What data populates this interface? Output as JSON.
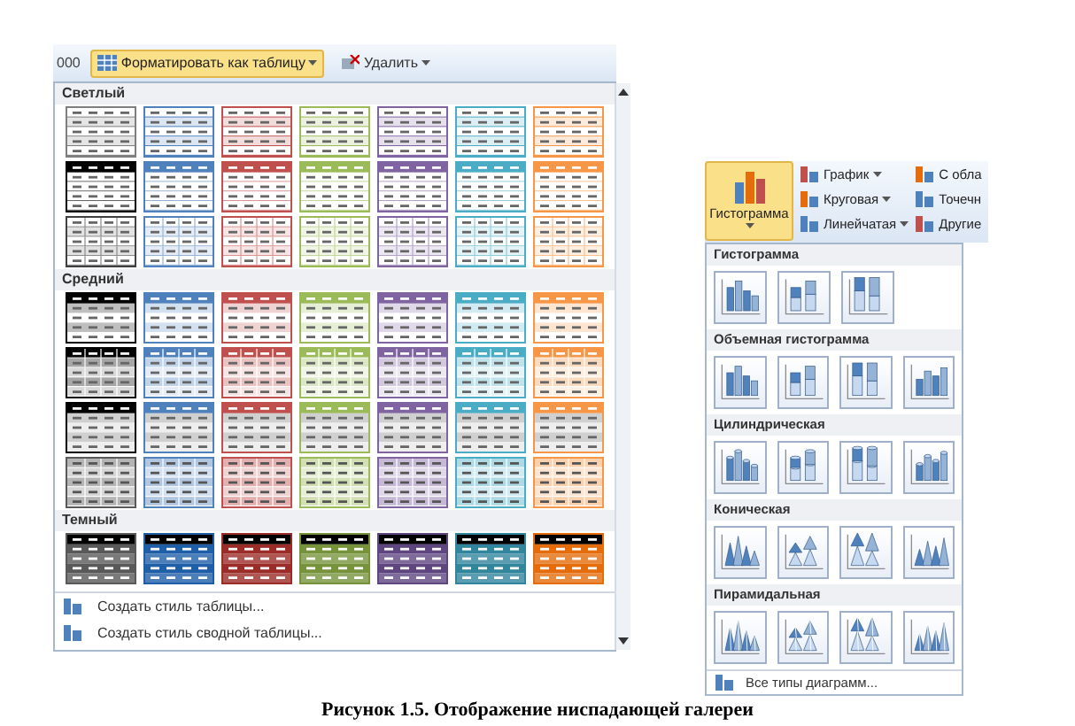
{
  "ribbon": {
    "number_format": "000",
    "format_button": {
      "label": "Форматировать как таблицу",
      "active": true
    },
    "delete_button": {
      "label": "Удалить"
    }
  },
  "table_styles": {
    "sections": [
      {
        "title": "Светлый",
        "rows": [
          {
            "kind": "lines",
            "items": [
              {
                "color": "#7f7f7f"
              },
              {
                "color": "#4f81bd"
              },
              {
                "color": "#c0504d"
              },
              {
                "color": "#9bbb59"
              },
              {
                "color": "#8064a2"
              },
              {
                "color": "#4bacc6"
              },
              {
                "color": "#f79646"
              }
            ]
          },
          {
            "kind": "header-border",
            "items": [
              {
                "color": "#000000"
              },
              {
                "color": "#4f81bd"
              },
              {
                "color": "#c0504d"
              },
              {
                "color": "#9bbb59"
              },
              {
                "color": "#8064a2"
              },
              {
                "color": "#4bacc6"
              },
              {
                "color": "#f79646"
              }
            ]
          },
          {
            "kind": "grid",
            "items": [
              {
                "color": "#404040"
              },
              {
                "color": "#4f81bd"
              },
              {
                "color": "#c0504d"
              },
              {
                "color": "#9bbb59"
              },
              {
                "color": "#8064a2"
              },
              {
                "color": "#4bacc6"
              },
              {
                "color": "#f79646"
              }
            ]
          }
        ]
      },
      {
        "title": "Средний",
        "rows": [
          {
            "kind": "header-bands",
            "items": [
              {
                "color": "#000000"
              },
              {
                "color": "#4f81bd"
              },
              {
                "color": "#c0504d"
              },
              {
                "color": "#9bbb59"
              },
              {
                "color": "#8064a2"
              },
              {
                "color": "#4bacc6"
              },
              {
                "color": "#f79646"
              }
            ]
          },
          {
            "kind": "grid-bands",
            "items": [
              {
                "color": "#000000"
              },
              {
                "color": "#4f81bd"
              },
              {
                "color": "#c0504d"
              },
              {
                "color": "#9bbb59"
              },
              {
                "color": "#8064a2"
              },
              {
                "color": "#4bacc6"
              },
              {
                "color": "#f79646"
              }
            ]
          },
          {
            "kind": "header-gray",
            "items": [
              {
                "color": "#000000"
              },
              {
                "color": "#4f81bd"
              },
              {
                "color": "#c0504d"
              },
              {
                "color": "#9bbb59"
              },
              {
                "color": "#8064a2"
              },
              {
                "color": "#4bacc6"
              },
              {
                "color": "#f79646"
              }
            ]
          },
          {
            "kind": "grid-filled",
            "items": [
              {
                "color": "#595959"
              },
              {
                "color": "#4f81bd"
              },
              {
                "color": "#c0504d"
              },
              {
                "color": "#9bbb59"
              },
              {
                "color": "#8064a2"
              },
              {
                "color": "#4bacc6"
              },
              {
                "color": "#f79646"
              }
            ]
          }
        ]
      },
      {
        "title": "Темный",
        "rows": [
          {
            "kind": "dark",
            "items": [
              {
                "color": "#595959"
              },
              {
                "color": "#1f5fa8"
              },
              {
                "color": "#9b2c28"
              },
              {
                "color": "#76933c"
              },
              {
                "color": "#5f4680"
              },
              {
                "color": "#31859c"
              },
              {
                "color": "#e46c0a"
              }
            ]
          }
        ]
      }
    ]
  },
  "table_menu": [
    {
      "label": "Создать стиль таблицы..."
    },
    {
      "label": "Создать стиль сводной таблицы..."
    }
  ],
  "chart_ribbon": {
    "main_button": {
      "label": "Гистограмма",
      "active": true
    },
    "columns": [
      [
        {
          "label": "График",
          "dropdown": true
        },
        {
          "label": "Круговая",
          "dropdown": true
        },
        {
          "label": "Линейчатая",
          "dropdown": true
        }
      ],
      [
        {
          "label": "С обла",
          "dropdown": false
        },
        {
          "label": "Точечн",
          "dropdown": false
        },
        {
          "label": "Другие",
          "dropdown": false
        }
      ]
    ]
  },
  "chart_gallery": {
    "sections": [
      {
        "title": "Гистограмма",
        "kind": "bar",
        "icons": [
          {
            "kind": "clustered"
          },
          {
            "kind": "stacked"
          },
          {
            "kind": "percent"
          }
        ]
      },
      {
        "title": "Объемная гистограмма",
        "kind": "bar",
        "icons": [
          {
            "kind": "clustered"
          },
          {
            "kind": "stacked"
          },
          {
            "kind": "percent"
          },
          {
            "kind": "depth"
          }
        ]
      },
      {
        "title": "Цилиндрическая",
        "kind": "cylinder",
        "icons": [
          {
            "kind": "clustered"
          },
          {
            "kind": "stacked"
          },
          {
            "kind": "percent"
          },
          {
            "kind": "depth"
          }
        ]
      },
      {
        "title": "Коническая",
        "kind": "cone",
        "icons": [
          {
            "kind": "clustered"
          },
          {
            "kind": "stacked"
          },
          {
            "kind": "percent"
          },
          {
            "kind": "depth"
          }
        ]
      },
      {
        "title": "Пирамидальная",
        "kind": "pyramid",
        "icons": [
          {
            "kind": "clustered"
          },
          {
            "kind": "stacked"
          },
          {
            "kind": "percent"
          },
          {
            "kind": "depth"
          }
        ]
      }
    ],
    "all_types_link": "Все типы диаграмм..."
  },
  "caption": "Рисунок 1.5. Отображение ниспадающей галереи"
}
